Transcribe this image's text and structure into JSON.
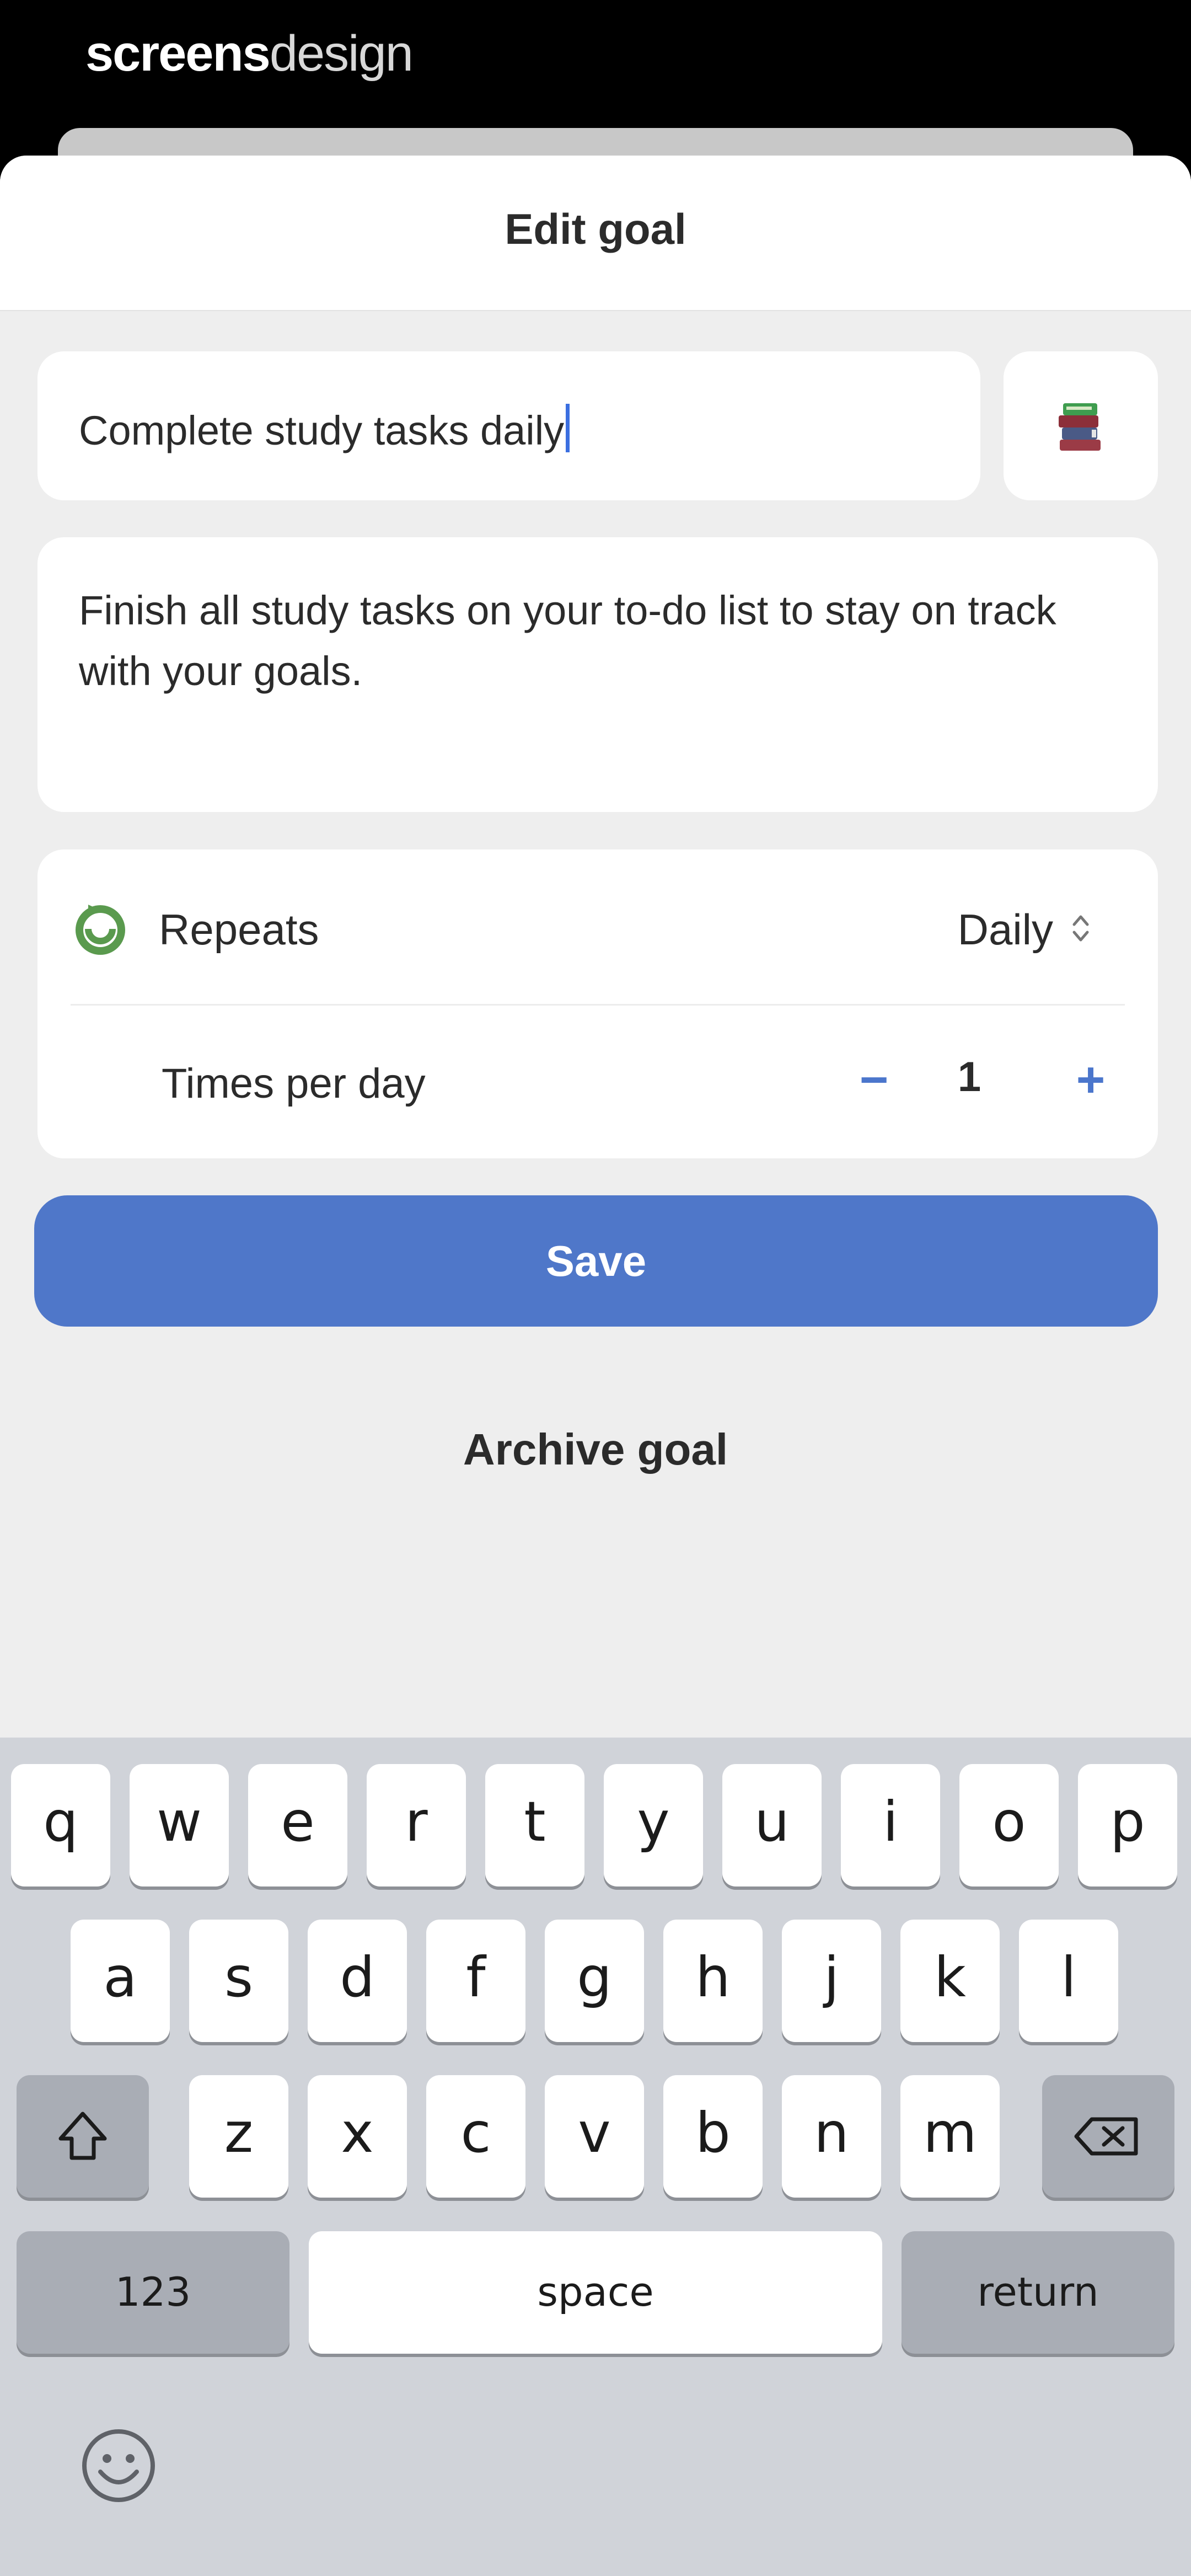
{
  "brand": {
    "bold": "screens",
    "light": "design"
  },
  "header": {
    "title": "Edit goal"
  },
  "goal": {
    "title_value": "Complete study tasks daily",
    "emoji_icon": "books-icon",
    "description": "Finish all study tasks on your to-do list to stay on track with your goals."
  },
  "options": {
    "repeats_label": "Repeats",
    "repeats_value": "Daily",
    "times_label": "Times per day",
    "times_value": "1",
    "minus_label": "−",
    "plus_label": "+"
  },
  "actions": {
    "save_label": "Save",
    "archive_label": "Archive goal"
  },
  "keyboard": {
    "row1": [
      "q",
      "w",
      "e",
      "r",
      "t",
      "y",
      "u",
      "i",
      "o",
      "p"
    ],
    "row2": [
      "a",
      "s",
      "d",
      "f",
      "g",
      "h",
      "j",
      "k",
      "l"
    ],
    "row3": [
      "z",
      "x",
      "c",
      "v",
      "b",
      "n",
      "m"
    ],
    "numbers_label": "123",
    "space_label": "space",
    "return_label": "return"
  },
  "colors": {
    "accent": "#4f77c9",
    "background": "#eeeeee",
    "keyboard": "#d0d3d9"
  }
}
